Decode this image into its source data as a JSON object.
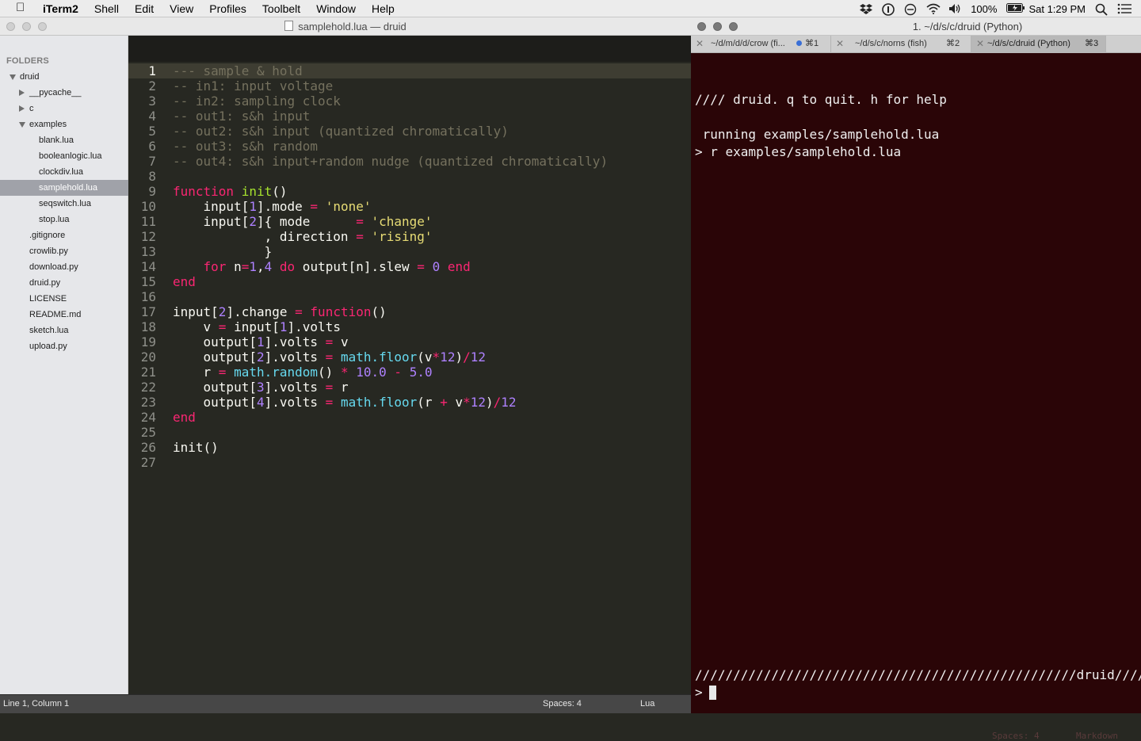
{
  "menubar": {
    "apple_glyph": "",
    "app_name": "iTerm2",
    "items": [
      "Shell",
      "Edit",
      "View",
      "Profiles",
      "Toolbelt",
      "Window",
      "Help"
    ],
    "battery": "100%",
    "clock": "Sat 1:29 PM",
    "icons": [
      "dropbox-icon",
      "1password-icon",
      "do-not-disturb-icon",
      "wifi-icon",
      "volume-icon",
      "battery-icon",
      "spotlight-icon",
      "notification-center-icon"
    ]
  },
  "sublime": {
    "title": "samplehold.lua — druid",
    "sidebar": {
      "header": "FOLDERS",
      "tree": [
        {
          "label": "druid",
          "depth": 0,
          "type": "folder-open"
        },
        {
          "label": "__pycache__",
          "depth": 1,
          "type": "folder-closed"
        },
        {
          "label": "c",
          "depth": 1,
          "type": "folder-closed"
        },
        {
          "label": "examples",
          "depth": 1,
          "type": "folder-open"
        },
        {
          "label": "blank.lua",
          "depth": 2,
          "type": "file"
        },
        {
          "label": "booleanlogic.lua",
          "depth": 2,
          "type": "file"
        },
        {
          "label": "clockdiv.lua",
          "depth": 2,
          "type": "file"
        },
        {
          "label": "samplehold.lua",
          "depth": 2,
          "type": "file",
          "selected": true
        },
        {
          "label": "seqswitch.lua",
          "depth": 2,
          "type": "file"
        },
        {
          "label": "stop.lua",
          "depth": 2,
          "type": "file"
        },
        {
          "label": ".gitignore",
          "depth": 1,
          "type": "file"
        },
        {
          "label": "crowlib.py",
          "depth": 1,
          "type": "file"
        },
        {
          "label": "download.py",
          "depth": 1,
          "type": "file"
        },
        {
          "label": "druid.py",
          "depth": 1,
          "type": "file"
        },
        {
          "label": "LICENSE",
          "depth": 1,
          "type": "file"
        },
        {
          "label": "README.md",
          "depth": 1,
          "type": "file"
        },
        {
          "label": "sketch.lua",
          "depth": 1,
          "type": "file"
        },
        {
          "label": "upload.py",
          "depth": 1,
          "type": "file"
        }
      ]
    },
    "current_line": 1,
    "code": [
      [
        [
          "cm",
          "--- sample & hold"
        ]
      ],
      [
        [
          "cm",
          "-- in1: input voltage"
        ]
      ],
      [
        [
          "cm",
          "-- in2: sampling clock"
        ]
      ],
      [
        [
          "cm",
          "-- out1: s&h input"
        ]
      ],
      [
        [
          "cm",
          "-- out2: s&h input (quantized chromatically)"
        ]
      ],
      [
        [
          "cm",
          "-- out3: s&h random"
        ]
      ],
      [
        [
          "cm",
          "-- out4: s&h input+random nudge (quantized chromatically)"
        ]
      ],
      [],
      [
        [
          "kw",
          "function"
        ],
        [
          "",
          " "
        ],
        [
          "fn",
          "init"
        ],
        [
          "",
          "()"
        ]
      ],
      [
        [
          "",
          "    input["
        ],
        [
          "nm",
          "1"
        ],
        [
          "",
          "].mode "
        ],
        [
          "op",
          "="
        ],
        [
          "",
          " "
        ],
        [
          "str",
          "'none'"
        ]
      ],
      [
        [
          "",
          "    input["
        ],
        [
          "nm",
          "2"
        ],
        [
          "",
          "]{ mode      "
        ],
        [
          "op",
          "="
        ],
        [
          "",
          " "
        ],
        [
          "str",
          "'change'"
        ]
      ],
      [
        [
          "",
          "            , direction "
        ],
        [
          "op",
          "="
        ],
        [
          "",
          " "
        ],
        [
          "str",
          "'rising'"
        ]
      ],
      [
        [
          "",
          "            }"
        ]
      ],
      [
        [
          "",
          "    "
        ],
        [
          "kw",
          "for"
        ],
        [
          "",
          " n"
        ],
        [
          "op",
          "="
        ],
        [
          "nm",
          "1"
        ],
        [
          "",
          ","
        ],
        [
          "nm",
          "4"
        ],
        [
          "",
          " "
        ],
        [
          "kw",
          "do"
        ],
        [
          "",
          " output[n].slew "
        ],
        [
          "op",
          "="
        ],
        [
          "",
          " "
        ],
        [
          "nm",
          "0"
        ],
        [
          "",
          " "
        ],
        [
          "kw",
          "end"
        ]
      ],
      [
        [
          "kw",
          "end"
        ]
      ],
      [],
      [
        [
          "",
          "input["
        ],
        [
          "nm",
          "2"
        ],
        [
          "",
          "].change "
        ],
        [
          "op",
          "="
        ],
        [
          "",
          " "
        ],
        [
          "kw",
          "function"
        ],
        [
          "",
          "()"
        ]
      ],
      [
        [
          "",
          "    v "
        ],
        [
          "op",
          "="
        ],
        [
          "",
          " input["
        ],
        [
          "nm",
          "1"
        ],
        [
          "",
          "].volts"
        ]
      ],
      [
        [
          "",
          "    output["
        ],
        [
          "nm",
          "1"
        ],
        [
          "",
          "].volts "
        ],
        [
          "op",
          "="
        ],
        [
          "",
          " v"
        ]
      ],
      [
        [
          "",
          "    output["
        ],
        [
          "nm",
          "2"
        ],
        [
          "",
          "].volts "
        ],
        [
          "op",
          "="
        ],
        [
          "",
          " "
        ],
        [
          "lib",
          "math.floor"
        ],
        [
          "",
          "(v"
        ],
        [
          "op",
          "*"
        ],
        [
          "nm",
          "12"
        ],
        [
          "",
          ")"
        ],
        [
          "op",
          "/"
        ],
        [
          "nm",
          "12"
        ]
      ],
      [
        [
          "",
          "    r "
        ],
        [
          "op",
          "="
        ],
        [
          "",
          " "
        ],
        [
          "lib",
          "math.random"
        ],
        [
          "",
          "() "
        ],
        [
          "op",
          "*"
        ],
        [
          "",
          " "
        ],
        [
          "nm",
          "10.0"
        ],
        [
          "",
          " "
        ],
        [
          "op",
          "-"
        ],
        [
          "",
          " "
        ],
        [
          "nm",
          "5.0"
        ]
      ],
      [
        [
          "",
          "    output["
        ],
        [
          "nm",
          "3"
        ],
        [
          "",
          "].volts "
        ],
        [
          "op",
          "="
        ],
        [
          "",
          " r"
        ]
      ],
      [
        [
          "",
          "    output["
        ],
        [
          "nm",
          "4"
        ],
        [
          "",
          "].volts "
        ],
        [
          "op",
          "="
        ],
        [
          "",
          " "
        ],
        [
          "lib",
          "math.floor"
        ],
        [
          "",
          "(r "
        ],
        [
          "op",
          "+"
        ],
        [
          "",
          " v"
        ],
        [
          "op",
          "*"
        ],
        [
          "nm",
          "12"
        ],
        [
          "",
          ")"
        ],
        [
          "op",
          "/"
        ],
        [
          "nm",
          "12"
        ]
      ],
      [
        [
          "kw",
          "end"
        ]
      ],
      [],
      [
        [
          "",
          "init()"
        ]
      ],
      []
    ],
    "status": {
      "position": "Line 1, Column 1",
      "spaces": "Spaces: 4",
      "syntax": "Lua"
    }
  },
  "iterm": {
    "title": "1. ~/d/s/c/druid (Python)",
    "tabs": [
      {
        "label": "~/d/m/d/d/crow (fi...",
        "shortcut": "⌘1",
        "dot": true,
        "active": false
      },
      {
        "label": "~/d/s/c/norns (fish)",
        "shortcut": "⌘2",
        "dot": false,
        "active": false
      },
      {
        "label": "~/d/s/c/druid (Python)",
        "shortcut": "⌘3",
        "dot": false,
        "active": true
      }
    ],
    "terminal_lines": [
      "//// druid. q to quit. h for help",
      " running examples/samplehold.lua",
      "> r examples/samplehold.lua"
    ],
    "footer_rule": "//////////////////////////////////////////////////druid////",
    "prompt": "> ",
    "ghost_status": {
      "spaces": "Spaces: 4",
      "syntax": "Markdown"
    }
  },
  "colors": {
    "editor_bg": "#272822",
    "terminal_bg": "#2a0507",
    "comment": "#75715e",
    "keyword": "#f92672",
    "number": "#ae81ff",
    "string": "#e6db74",
    "function": "#a6e22e",
    "library": "#66d9ef"
  }
}
